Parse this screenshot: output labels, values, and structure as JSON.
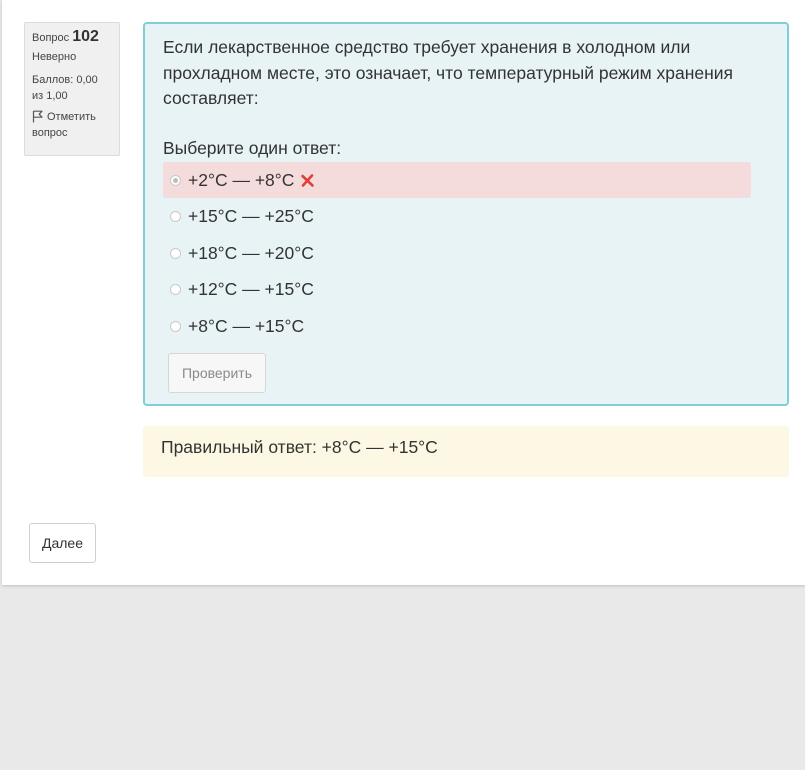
{
  "question_info": {
    "label": "Вопрос",
    "number": "102",
    "state": "Неверно",
    "grade": "Баллов: 0,00 из 1,00",
    "flag_label": "Отметить вопрос"
  },
  "question": {
    "text": "Если лекарственное средство требует хранения в холодном или прохладном месте, это означает, что температурный режим хранения составляет:",
    "prompt": "Выберите один ответ:",
    "answers": [
      {
        "label": "+2°C — +8°C",
        "selected": true,
        "incorrect": true
      },
      {
        "label": "+15°C — +25°C",
        "selected": false
      },
      {
        "label": "+18°C — +20°C",
        "selected": false
      },
      {
        "label": "+12°C — +15°C",
        "selected": false
      },
      {
        "label": "+8°C — +15°C",
        "selected": false
      }
    ],
    "check_button": "Проверить"
  },
  "feedback": {
    "right_answer": "Правильный ответ: +8°C — +15°C"
  },
  "navigation": {
    "next_button": "Далее"
  },
  "icons": {
    "flag": "flag-icon",
    "incorrect": "cross-icon"
  },
  "colors": {
    "formulation_bg": "#e7f3f5",
    "formulation_border": "#7fcfd8",
    "incorrect_bg": "#f5dcdc",
    "outcome_bg": "#fcf8e3",
    "cross": "#e0403a"
  }
}
